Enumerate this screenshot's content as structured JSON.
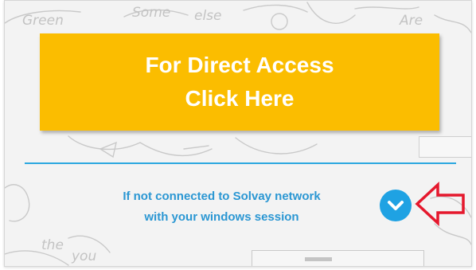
{
  "direct_access": {
    "line1": "For Direct Access",
    "line2": "Click Here"
  },
  "network_note": {
    "line1": "If not connected to Solvay network",
    "line2": "with your windows session"
  },
  "background_sketch_words": {
    "w1": "Green",
    "w2": "Some",
    "w3": "else",
    "w4": "Are",
    "w5": "the",
    "w6": "you"
  },
  "colors": {
    "button": "#fbbd00",
    "accent": "#2ba7df",
    "expand": "#1fa2e3",
    "arrow": "#e5182d"
  },
  "icons": {
    "expand": "chevron-down-icon",
    "pointer": "red-arrow-left-icon"
  }
}
